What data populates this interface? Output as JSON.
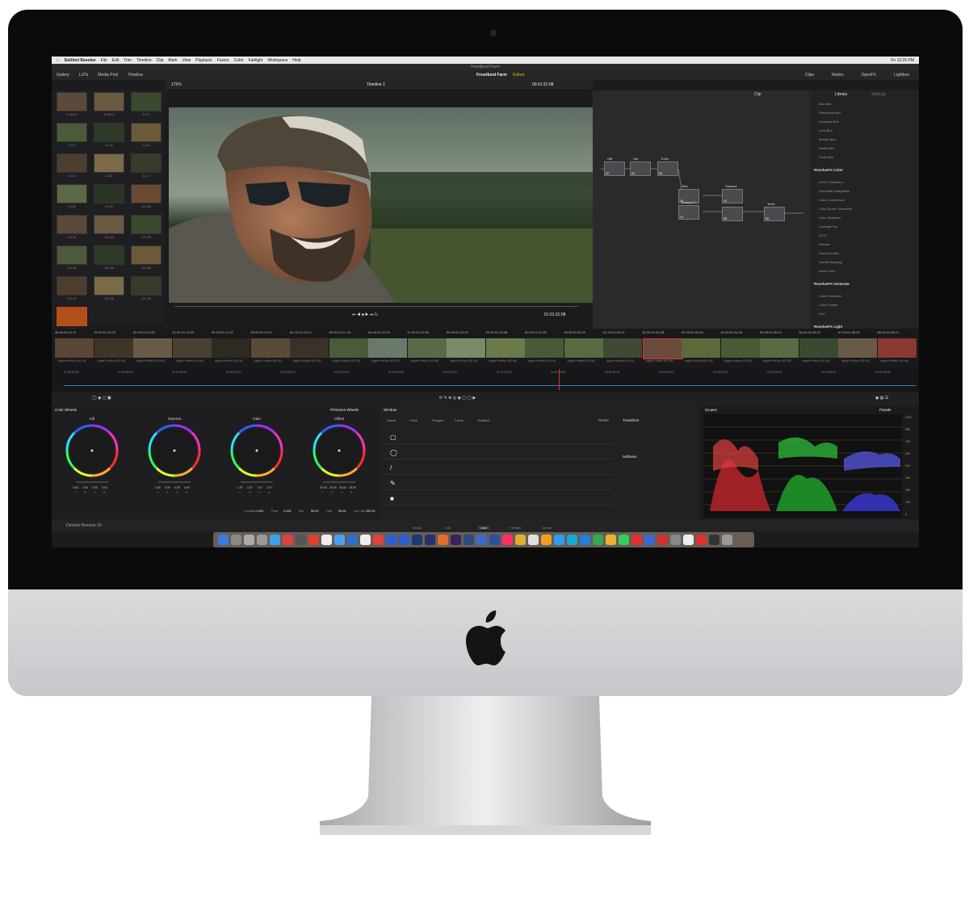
{
  "menubar": {
    "app_name": "DaVinci Resolve",
    "items": [
      "File",
      "Edit",
      "Trim",
      "Timeline",
      "Clip",
      "Mark",
      "View",
      "Playback",
      "Fusion",
      "Color",
      "Fairlight",
      "Workspace",
      "Help"
    ],
    "clock": "Fri 12:25 PM"
  },
  "window_title": "Freedlund Farm",
  "toolbar": {
    "gallery": "Gallery",
    "luts": "LUTs",
    "media_pool": "Media Pool",
    "timeline": "Timeline",
    "project": "Freedlund Farm",
    "status": "Edited",
    "clips": "Clips",
    "nodes": "Nodes",
    "openfx": "OpenFX",
    "lightbox": "Lightbox"
  },
  "viewer": {
    "zoom": "179%",
    "timeline_name": "Timeline 1",
    "timecode_top": "00:01:31:08",
    "timecode_bottom": "01:01:31:08",
    "mode": "Clip"
  },
  "gallery_thumbs": [
    "1.114.1",
    "1.107.1",
    "2.1.1",
    "2.1.2",
    "2.1.3",
    "2.1.4",
    "2.1.5",
    "2.1.6",
    "2.1.7",
    "2.1.8",
    "2.1.9",
    "2.1.10",
    "2.1.11",
    "2.1.12",
    "2.1.13",
    "2.1.14",
    "2.1.15",
    "2.1.16",
    "2.1.17",
    "2.1.18",
    "2.1.19",
    "2.1.20"
  ],
  "nodes": {
    "labels": [
      "WB",
      "Sat",
      "Trees",
      "Skin",
      "Sharpen F...",
      "Glasses",
      "Teeth"
    ],
    "numbers": [
      "02",
      "04",
      "05",
      "10",
      "12",
      "14",
      "08",
      "09"
    ]
  },
  "library": {
    "tab": "Library",
    "settings": "Settings",
    "blur_items": [
      "Box Blur",
      "Directional Blur",
      "Gaussian Blur",
      "Lens Blur",
      "Mosaic Blur",
      "Radial Blur",
      "Zoom Blur"
    ],
    "color_header": "ResolveFX Color",
    "color_items": [
      "ACES Transform",
      "Chromatic Adaptation",
      "Color Compressor",
      "Color Space Transform",
      "Color Stabilizer",
      "Contrast Pop",
      "DCTL",
      "Dehaze",
      "Gamut Limiter",
      "Gamut Mapping",
      "Invert Color"
    ],
    "generate_header": "ResolveFX Generate",
    "generate_items": [
      "Color Generator",
      "Color Palette",
      "Grid"
    ],
    "light_header": "ResolveFX Light"
  },
  "clips": [
    {
      "num": "48",
      "tc": "00:00:10:11"
    },
    {
      "num": "49",
      "tc": "00:01:11:03"
    },
    {
      "num": "50",
      "tc": "00:01:12:06"
    },
    {
      "num": "51",
      "tc": "00:01:15:02"
    },
    {
      "num": "52",
      "tc": "00:01:17:02"
    },
    {
      "num": "53",
      "tc": "00:01:19:01"
    },
    {
      "num": "54",
      "tc": "00:01:20:12"
    },
    {
      "num": "55",
      "tc": "00:01:21:18"
    },
    {
      "num": "56",
      "tc": "00:01:22:19"
    },
    {
      "num": "57",
      "tc": "00:01:24:05"
    },
    {
      "num": "58",
      "tc": "00:01:25:20"
    },
    {
      "num": "59",
      "tc": "00:01:26:08"
    },
    {
      "num": "60",
      "tc": "00:01:27:06"
    },
    {
      "num": "60",
      "tc": "00:01:28:22"
    },
    {
      "num": "61",
      "tc": "00:01:29:21"
    },
    {
      "num": "62",
      "tc": "00:01:31:08"
    },
    {
      "num": "63",
      "tc": "00:01:32:04"
    },
    {
      "num": "64",
      "tc": "00:01:34:18"
    },
    {
      "num": "65",
      "tc": "00:01:35:14"
    },
    {
      "num": "66",
      "tc": "00:01:36:12"
    },
    {
      "num": "67",
      "tc": "00:01:38:00"
    },
    {
      "num": "68",
      "tc": "00:01:38:21"
    }
  ],
  "clip_codec": "Apple ProRes 422 HQ",
  "ruler_ticks": [
    "01:00:00:00",
    "01:00:55:23",
    "01:00:59:22",
    "01:00:29:21",
    "01:00:09:20",
    "01:00:49:19",
    "01:00:59:18",
    "01:00:09:17",
    "01:01:19:16",
    "01:01:29:15",
    "01:00:59:14",
    "01:00:59:13",
    "01:00:59:12",
    "01:00:59:11",
    "01:00:59:10",
    "01:02:09:09"
  ],
  "color_wheels": {
    "title": "Color Wheels",
    "mode": "Primaries Wheels",
    "wheels": [
      {
        "name": "Lift",
        "values": [
          "0.00",
          "0.00",
          "0.00",
          "0.00"
        ]
      },
      {
        "name": "Gamma",
        "values": [
          "0.00",
          "0.00",
          "0.00",
          "0.00"
        ]
      },
      {
        "name": "Gain",
        "values": [
          "1.07",
          "1.07",
          "1.07",
          "1.07"
        ]
      },
      {
        "name": "Offset",
        "values": [
          "25.00",
          "25.00",
          "25.00",
          "25.00"
        ]
      }
    ],
    "channels": [
      "Y",
      "R",
      "G",
      "B"
    ],
    "bottom": [
      {
        "label": "Contrast",
        "value": "1.000"
      },
      {
        "label": "Pivot",
        "value": "0.435"
      },
      {
        "label": "Sat",
        "value": "50.00"
      },
      {
        "label": "Hue",
        "value": "50.00"
      },
      {
        "label": "Lum Mix",
        "value": "100.00"
      }
    ]
  },
  "window_panel": {
    "title": "Window",
    "tools": [
      "Linear",
      "Circle",
      "Polygon",
      "Curve",
      "Gradient"
    ],
    "delete": "Delete",
    "transform": "Transform",
    "softness": "Softness"
  },
  "scopes": {
    "title": "Scopes",
    "mode": "Parade",
    "scale": [
      "1023",
      "896",
      "768",
      "640",
      "512",
      "384",
      "256",
      "128",
      "0"
    ]
  },
  "bottom_nav": {
    "app": "DaVinci Resolve 15",
    "tabs": [
      "Media",
      "Edit",
      "Color",
      "Fairlight",
      "Deliver"
    ]
  },
  "colors": {
    "accent_yellow": "#e6b400",
    "selected_clip": "#c0392b"
  }
}
